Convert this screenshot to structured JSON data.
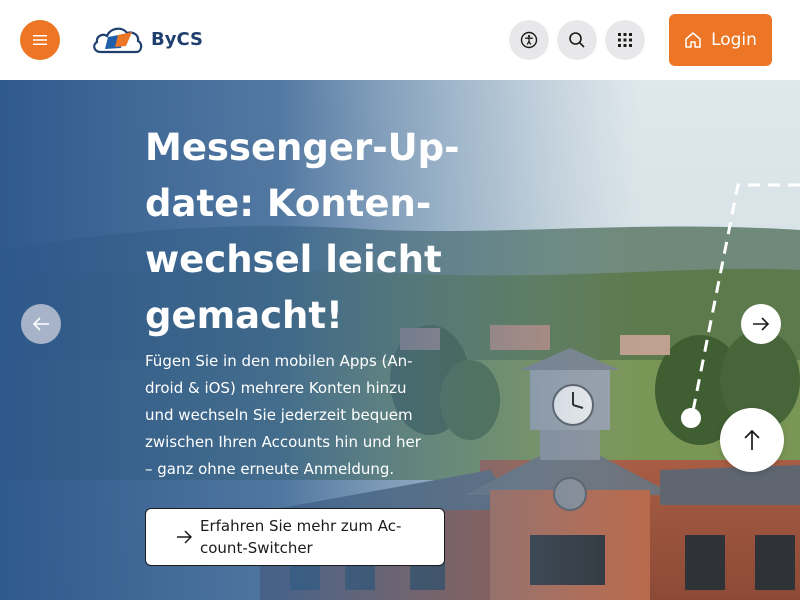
{
  "header": {
    "logo_text": "ByCS",
    "login_label": "Login",
    "icons": [
      "menu-icon",
      "accessibility-icon",
      "search-icon",
      "apps-grid-icon",
      "home-icon"
    ]
  },
  "hero": {
    "headline_lines": [
      "Messenger-Up-",
      "date: Konten-",
      "wechsel leicht",
      "gemacht!"
    ],
    "description_lines": [
      "Fügen Sie in den mobilen Apps (An-",
      "droid & iOS) mehrere Konten hinzu",
      "und wechseln Sie jederzeit bequem",
      "zwischen Ihren Accounts hin und her",
      "– ganz ohne erneute Anmeldung."
    ],
    "cta_lines": [
      "Erfahren Sie mehr zum Ac-",
      "count-Switcher"
    ]
  },
  "colors": {
    "accent": "#ec7626",
    "brand_blue": "#1f3f6e",
    "overlay_blue": "#2e5a8e"
  }
}
